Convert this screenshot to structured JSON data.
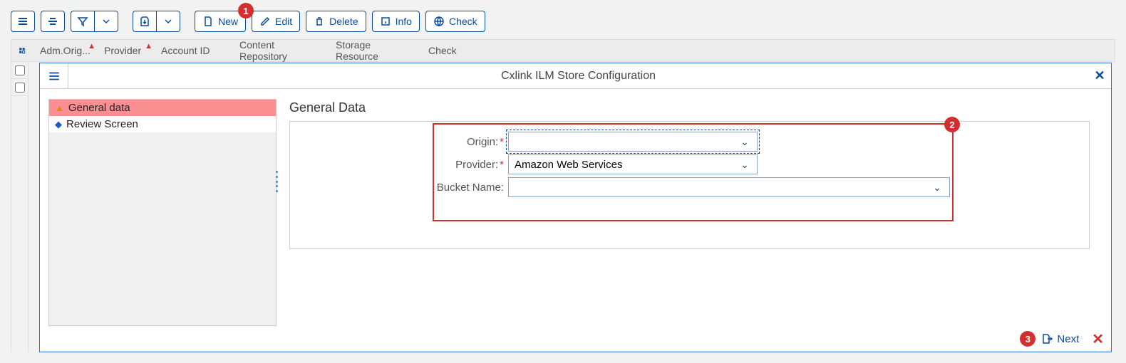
{
  "toolbar": {
    "new_label": "New",
    "edit_label": "Edit",
    "delete_label": "Delete",
    "info_label": "Info",
    "check_label": "Check"
  },
  "callouts": {
    "one": "1",
    "two": "2",
    "three": "3"
  },
  "grid": {
    "columns": {
      "adm_origin": "Adm.Orig...",
      "provider": "Provider",
      "account_id": "Account ID",
      "content_repository": "Content Repository",
      "storage_resource": "Storage Resource",
      "check": "Check"
    }
  },
  "dialog": {
    "title": "Cxlink ILM Store Configuration",
    "nav": {
      "general_data": "General data",
      "review_screen": "Review Screen"
    },
    "section_title": "General Data",
    "fields": {
      "origin_label": "Origin:",
      "origin_value": "",
      "provider_label": "Provider:",
      "provider_value": "Amazon Web Services",
      "bucket_label": "Bucket Name:",
      "bucket_value": ""
    },
    "footer": {
      "next_label": "Next"
    }
  }
}
